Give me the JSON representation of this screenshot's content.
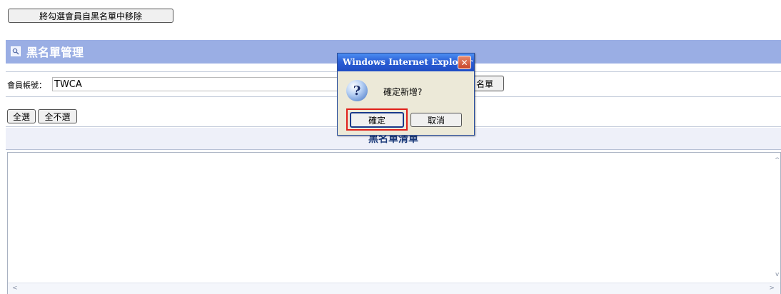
{
  "toolbar": {
    "remove_label": "將勾選會員自黑名單中移除"
  },
  "panel": {
    "title": "黑名單管理"
  },
  "account": {
    "label": "會員帳號：",
    "value": "TWCA",
    "add_label": "名單"
  },
  "select": {
    "all_label": "全選",
    "none_label": "全不選"
  },
  "list": {
    "title": "黑名單清單"
  },
  "dialog": {
    "title": "Windows Internet Explorer",
    "close": "✕",
    "icon": "question-icon",
    "message": "確定新增?",
    "ok_label": "確定",
    "cancel_label": "取消"
  },
  "colors": {
    "header": "#9aaee4",
    "dialog_title": "#2b5fd6",
    "highlight": "#e0201a"
  }
}
